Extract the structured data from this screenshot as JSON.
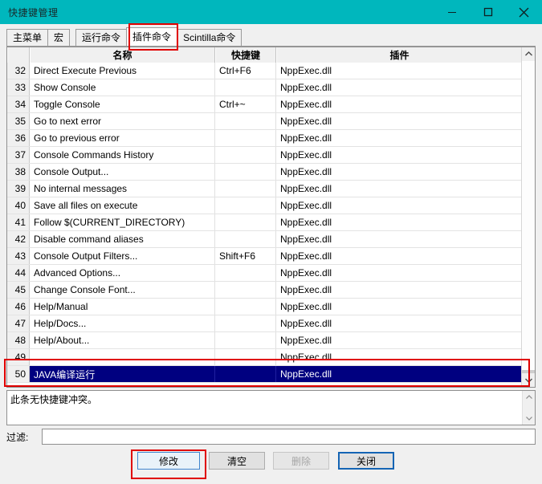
{
  "window": {
    "title": "快捷键管理",
    "controls": [
      {
        "name": "minimize",
        "glyph": "minimize-icon"
      },
      {
        "name": "maximize",
        "glyph": "maximize-icon"
      },
      {
        "name": "close",
        "glyph": "close-icon"
      }
    ],
    "accent_color": "#00b7bd"
  },
  "tabs": [
    {
      "label": "主菜单",
      "selected": false
    },
    {
      "label": "宏",
      "selected": false
    },
    {
      "label": "运行命令",
      "selected": false
    },
    {
      "label": "插件命令",
      "selected": true
    },
    {
      "label": "Scintilla命令",
      "selected": false
    }
  ],
  "grid": {
    "headers": [
      "",
      "名称",
      "快捷键",
      "插件"
    ],
    "rows": [
      {
        "num": "32",
        "name": "Direct Execute Previous",
        "key": "Ctrl+F6",
        "plugin": "NppExec.dll",
        "selected": false
      },
      {
        "num": "33",
        "name": "Show Console",
        "key": "",
        "plugin": "NppExec.dll",
        "selected": false
      },
      {
        "num": "34",
        "name": "Toggle Console",
        "key": "Ctrl+~",
        "plugin": "NppExec.dll",
        "selected": false
      },
      {
        "num": "35",
        "name": "Go to next error",
        "key": "",
        "plugin": "NppExec.dll",
        "selected": false
      },
      {
        "num": "36",
        "name": "Go to previous error",
        "key": "",
        "plugin": "NppExec.dll",
        "selected": false
      },
      {
        "num": "37",
        "name": "Console Commands History",
        "key": "",
        "plugin": "NppExec.dll",
        "selected": false
      },
      {
        "num": "38",
        "name": "Console Output...",
        "key": "",
        "plugin": "NppExec.dll",
        "selected": false
      },
      {
        "num": "39",
        "name": "No internal messages",
        "key": "",
        "plugin": "NppExec.dll",
        "selected": false
      },
      {
        "num": "40",
        "name": "Save all files on execute",
        "key": "",
        "plugin": "NppExec.dll",
        "selected": false
      },
      {
        "num": "41",
        "name": "Follow $(CURRENT_DIRECTORY)",
        "key": "",
        "plugin": "NppExec.dll",
        "selected": false
      },
      {
        "num": "42",
        "name": "Disable command aliases",
        "key": "",
        "plugin": "NppExec.dll",
        "selected": false
      },
      {
        "num": "43",
        "name": "Console Output Filters...",
        "key": "Shift+F6",
        "plugin": "NppExec.dll",
        "selected": false
      },
      {
        "num": "44",
        "name": "Advanced Options...",
        "key": "",
        "plugin": "NppExec.dll",
        "selected": false
      },
      {
        "num": "45",
        "name": "Change Console Font...",
        "key": "",
        "plugin": "NppExec.dll",
        "selected": false
      },
      {
        "num": "46",
        "name": "Help/Manual",
        "key": "",
        "plugin": "NppExec.dll",
        "selected": false
      },
      {
        "num": "47",
        "name": "Help/Docs...",
        "key": "",
        "plugin": "NppExec.dll",
        "selected": false
      },
      {
        "num": "48",
        "name": "Help/About...",
        "key": "",
        "plugin": "NppExec.dll",
        "selected": false
      },
      {
        "num": "49",
        "name": "",
        "key": "",
        "plugin": "NppExec.dll",
        "selected": false
      },
      {
        "num": "50",
        "name": "JAVA编译运行",
        "key": "",
        "plugin": "NppExec.dll",
        "selected": true
      }
    ]
  },
  "conflict": {
    "message": "此条无快捷键冲突。"
  },
  "filter": {
    "label": "过滤:",
    "value": "",
    "placeholder": ""
  },
  "buttons": {
    "modify": "修改",
    "clear": "清空",
    "delete": "删除",
    "close": "关闭"
  },
  "annotation": {
    "color": "#e00000"
  }
}
